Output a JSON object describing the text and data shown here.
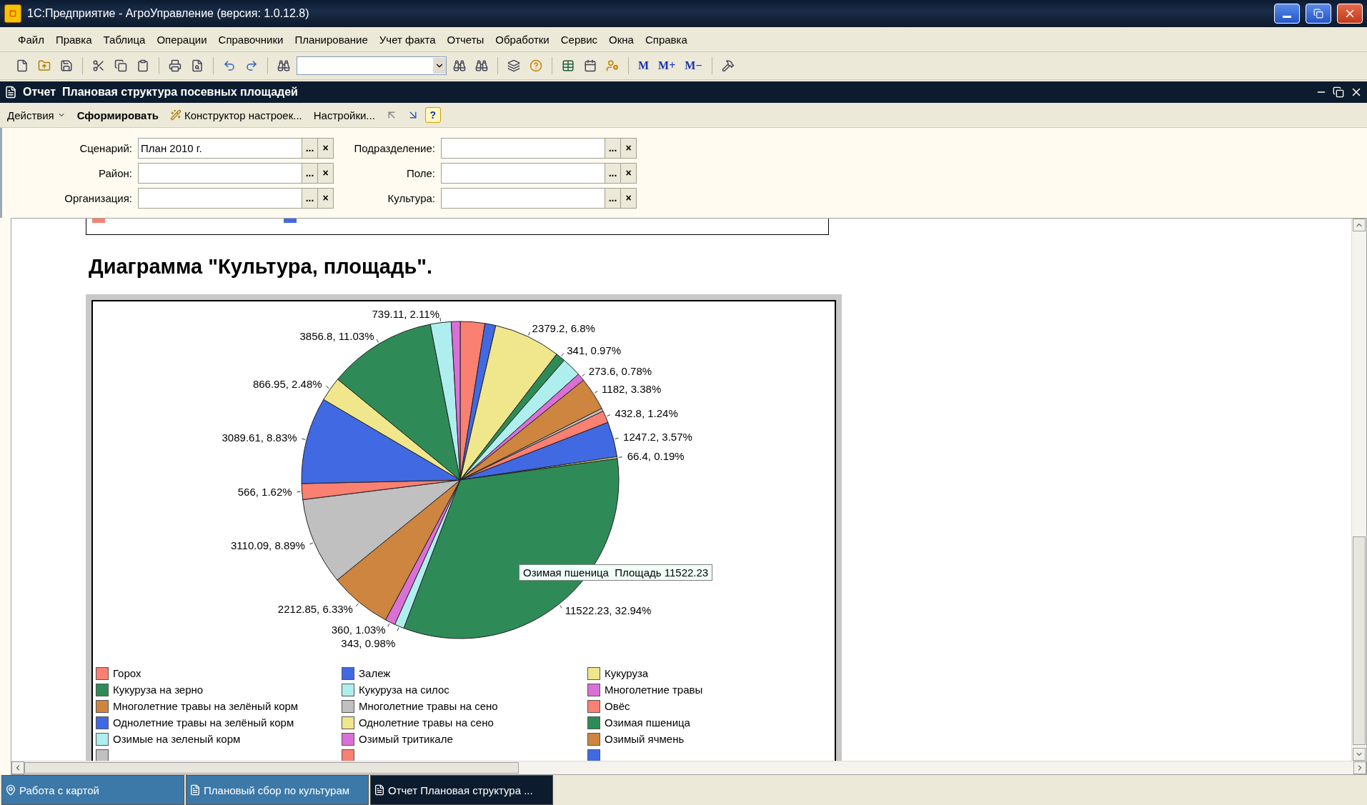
{
  "window": {
    "title": "1С:Предприятие - АгроУправление (версия: 1.0.12.8)"
  },
  "menu": [
    "Файл",
    "Правка",
    "Таблица",
    "Операции",
    "Справочники",
    "Планирование",
    "Учет факта",
    "Отчеты",
    "Обработки",
    "Сервис",
    "Окна",
    "Справка"
  ],
  "toolbar": {
    "memory_buttons": [
      "M",
      "M+",
      "M−"
    ]
  },
  "document": {
    "title": "Отчет  Плановая структура посевных площадей"
  },
  "actions": [
    {
      "label": "Действия",
      "kind": "menu"
    },
    {
      "label": "Сформировать",
      "kind": "primary"
    },
    {
      "label": "Конструктор настроек...",
      "kind": "icon"
    },
    {
      "label": "Настройки...",
      "kind": "plain"
    }
  ],
  "help_button": "?",
  "filters": [
    {
      "label": "Сценарий:",
      "value": "План 2010 г.",
      "select_button": "...",
      "clear_button": "×"
    },
    {
      "label": "Подразделение:",
      "select_button": "...",
      "clear_button": "×"
    },
    {
      "label": "Район:",
      "select_button": "...",
      "clear_button": "×"
    },
    {
      "label": "Поле:",
      "select_button": "...",
      "clear_button": "×"
    },
    {
      "label": "Организация:",
      "select_button": "...",
      "clear_button": "×"
    },
    {
      "label": "Культура:",
      "select_button": "...",
      "clear_button": "×"
    }
  ],
  "report": {
    "previous_legend_swatches": [
      {
        "color": "#fa8072"
      },
      {
        "color": "#4169e1"
      }
    ],
    "heading": "Диаграмма \"Культура, площадь\".",
    "chart_data": {
      "type": "pie",
      "data_labels": true,
      "values": [
        875,
        385,
        2379.2,
        341,
        700,
        273.6,
        1182,
        105,
        432.8,
        1247.2,
        66.4,
        11522.23,
        343,
        360,
        2212.85,
        3110.09,
        566,
        3089.61,
        866.95,
        3856.8,
        739.11,
        315
      ],
      "value_labels": [
        null,
        null,
        "2379.2, 6.8%",
        "341, 0.97%",
        null,
        "273.6, 0.78%",
        "1182, 3.38%",
        null,
        "432.8, 1.24%",
        "1247.2, 3.57%",
        "66.4, 0.19%",
        "11522.23, 32.94%",
        "343, 0.98%",
        "360, 1.03%",
        "2212.85, 6.33%",
        "3110.09, 8.89%",
        "566, 1.62%",
        "3089.61, 8.83%",
        "866.95, 2.48%",
        "3856.8, 11.03%",
        "739.11, 2.11%",
        null
      ],
      "colors": [
        "#fa8072",
        "#4169e1",
        "#f0e68c",
        "#2e8b57",
        "#afeeee",
        "#da70d6",
        "#cd853f",
        "#c0c0c0",
        "#fa8072",
        "#4169e1",
        "#f0e68c",
        "#2e8b57",
        "#afeeee",
        "#da70d6",
        "#cd853f",
        "#c0c0c0",
        "#fa8072",
        "#4169e1",
        "#f0e68c",
        "#2e8b57",
        "#afeeee",
        "#da70d6"
      ]
    },
    "tooltip": "Озимая пшеница  Площадь 11522.23",
    "legend": [
      {
        "label": "Горох",
        "color": "#fa8072"
      },
      {
        "label": "Залеж",
        "color": "#4169e1"
      },
      {
        "label": "Кукуруза",
        "color": "#f0e68c"
      },
      {
        "label": "Кукуруза на зерно",
        "color": "#2e8b57"
      },
      {
        "label": "Кукуруза на силос",
        "color": "#afeeee"
      },
      {
        "label": "Многолетние травы",
        "color": "#da70d6"
      },
      {
        "label": "Многолетние травы на зелёный корм",
        "color": "#cd853f"
      },
      {
        "label": "Многолетние травы на сено",
        "color": "#c0c0c0"
      },
      {
        "label": "Овёс",
        "color": "#fa8072"
      },
      {
        "label": "Однолетние травы на зелёный корм",
        "color": "#4169e1"
      },
      {
        "label": "Однолетние травы на сено",
        "color": "#f0e68c"
      },
      {
        "label": "Озимая пшеница",
        "color": "#2e8b57"
      },
      {
        "label": "Озимые на зеленый корм",
        "color": "#afeeee"
      },
      {
        "label": "Озимый тритикале",
        "color": "#da70d6"
      },
      {
        "label": "Озимый ячмень",
        "color": "#cd853f"
      }
    ],
    "legend_cut_swatches": [
      {
        "color": "#c0c0c0"
      },
      {
        "color": "#fa8072"
      },
      {
        "color": "#4169e1"
      }
    ]
  },
  "taskbar": [
    {
      "label": "Работа с картой",
      "selected": false
    },
    {
      "label": "Плановый сбор по культурам",
      "selected": false
    },
    {
      "label": "Отчет  Плановая структура ...",
      "selected": true
    }
  ]
}
